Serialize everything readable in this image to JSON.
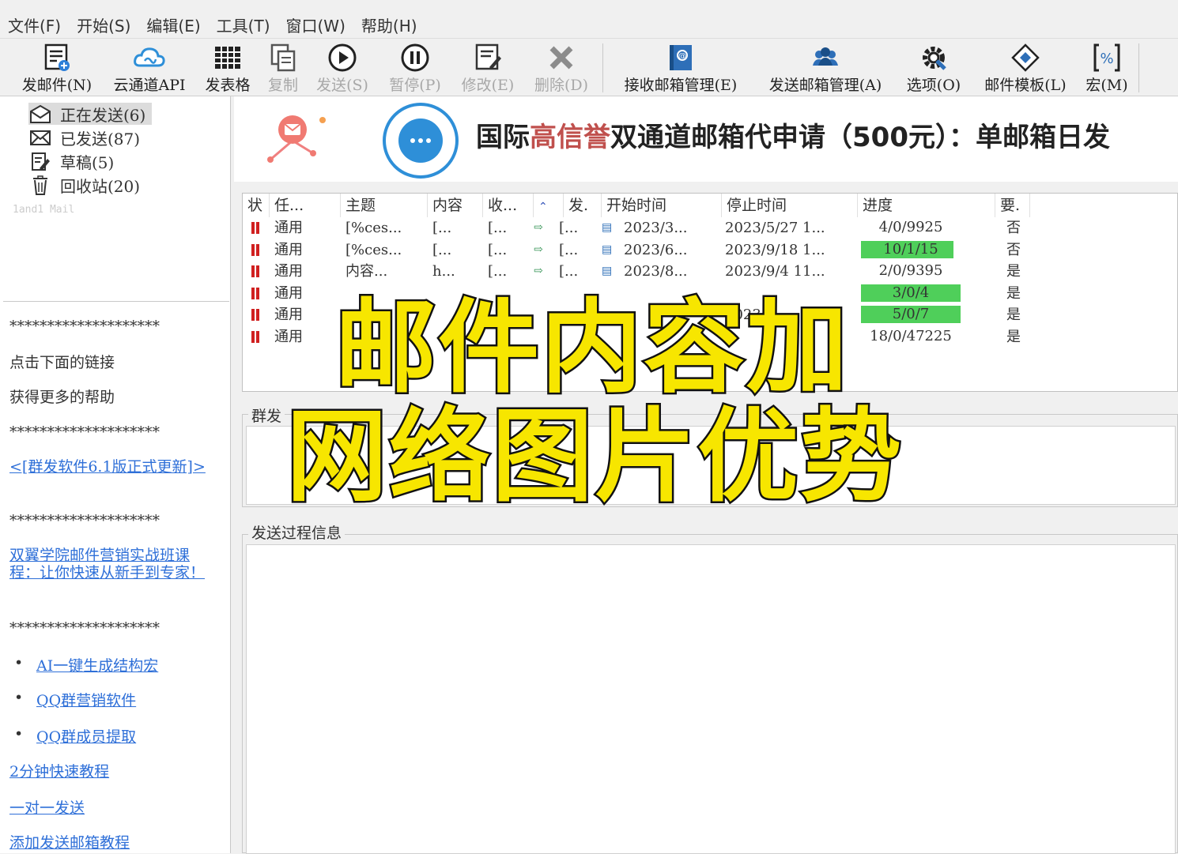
{
  "menu": [
    "文件(F)",
    "开始(S)",
    "编辑(E)",
    "工具(T)",
    "窗口(W)",
    "帮助(H)"
  ],
  "toolbar": {
    "new_mail": "发邮件(N)",
    "cloud_api": "云通道API",
    "send_table": "发表格",
    "copy": "复制",
    "send": "发送(S)",
    "pause": "暂停(P)",
    "edit": "修改(E)",
    "delete": "删除(D)",
    "recv_box": "接收邮箱管理(E)",
    "send_box": "发送邮箱管理(A)",
    "options": "选项(O)",
    "template": "邮件模板(L)",
    "macro": "宏(M)"
  },
  "folders": [
    {
      "label": "正在发送(6)",
      "icon": "sending-mailbox-icon"
    },
    {
      "label": "已发送(87)",
      "icon": "envelope-icon"
    },
    {
      "label": "草稿(5)",
      "icon": "draft-icon"
    },
    {
      "label": "回收站(20)",
      "icon": "trash-icon"
    }
  ],
  "folder_footer": "1and1 Mail",
  "help": {
    "stars": "********************",
    "click_link": "点击下面的链接",
    "more_help": "获得更多的帮助",
    "update_link": "<[群发软件6.1版正式更新]>",
    "course_link": "双翼学院邮件营销实战班课程：让你快速从新手到专家！",
    "ai_link": "AI一键生成结构宏",
    "qq_marketing": "QQ群营销软件",
    "qq_extract": "QQ群成员提取",
    "tutorial": "2分钟快速教程",
    "one_to_one": "一对一发送",
    "add_mailbox": "添加发送邮箱教程"
  },
  "banner": {
    "title_a": "国际",
    "title_hl": "高信誉",
    "title_b": "双通道邮箱代申请（500元）：单邮箱日发"
  },
  "table": {
    "headers": [
      "状",
      "任...",
      "主题",
      "内容",
      "收...",
      "",
      "发.",
      "开始时间",
      "停止时间",
      "进度",
      "要."
    ],
    "rows": [
      {
        "task": "通用",
        "subject": "[%ces...",
        "content": "[...",
        "recv": "[...",
        "send": "[...",
        "start": "2023/3...",
        "stop": "2023/5/27 1...",
        "progress": "4/0/9925",
        "pct": 0.0,
        "req": "否"
      },
      {
        "task": "通用",
        "subject": "[%ces...",
        "content": "[...",
        "recv": "[...",
        "send": "[...",
        "start": "2023/6...",
        "stop": "2023/9/18 1...",
        "progress": "10/1/15",
        "pct": 0.93,
        "req": "否"
      },
      {
        "task": "通用",
        "subject": "内容...",
        "content": "h...",
        "recv": "[...",
        "send": "[...",
        "start": "2023/8...",
        "stop": "2023/9/4 11...",
        "progress": "2/0/9395",
        "pct": 0.0,
        "req": "是"
      },
      {
        "task": "通用",
        "subject": "",
        "content": "",
        "recv": "",
        "send": "",
        "start": "",
        "stop": "",
        "progress": "3/0/4",
        "pct": 1.0,
        "req": "是"
      },
      {
        "task": "通用",
        "subject": "",
        "content": "",
        "recv": "",
        "send": "",
        "start": "",
        "stop": "2023",
        "progress": "5/0/7",
        "pct": 1.0,
        "req": "是"
      },
      {
        "task": "通用",
        "subject": "",
        "content": "",
        "recv": "",
        "send": "",
        "start": "",
        "stop": "",
        "progress": "18/0/47225",
        "pct": 0.0,
        "req": "是"
      }
    ]
  },
  "group_send_label": "群发",
  "process_info_label": "发送过程信息",
  "overlay": {
    "line1": "邮件内容加",
    "line2": "网络图片优势"
  },
  "colors": {
    "progress_fill": "#4fcf5a",
    "pause_red": "#d02020",
    "overlay_yellow": "#f7e600",
    "link_blue": "#2e6fd8",
    "highlight_red": "#c0504d"
  }
}
